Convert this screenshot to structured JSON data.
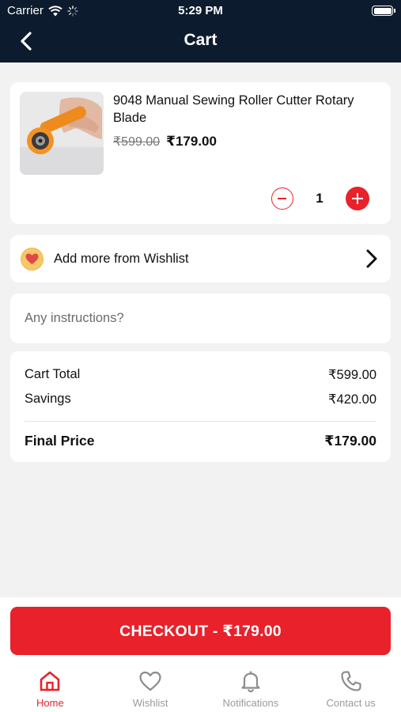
{
  "status": {
    "carrier": "Carrier",
    "time": "5:29 PM"
  },
  "header": {
    "title": "Cart"
  },
  "cart_item": {
    "name": "9048 Manual Sewing Roller Cutter Rotary Blade",
    "original_price": "₹599.00",
    "price": "₹179.00",
    "quantity": "1"
  },
  "wishlist_link": {
    "label": "Add more from Wishlist"
  },
  "instructions": {
    "placeholder": "Any instructions?"
  },
  "summary": {
    "cart_total_label": "Cart Total",
    "cart_total_value": "₹599.00",
    "savings_label": "Savings",
    "savings_value": "₹420.00",
    "final_label": "Final Price",
    "final_value": "₹179.00"
  },
  "checkout": {
    "label": "CHECKOUT - ₹179.00"
  },
  "tabs": [
    {
      "label": "Home",
      "icon": "home-icon",
      "active": true
    },
    {
      "label": "Wishlist",
      "icon": "heart-icon",
      "active": false
    },
    {
      "label": "Notifications",
      "icon": "bell-icon",
      "active": false
    },
    {
      "label": "Contact us",
      "icon": "phone-icon",
      "active": false
    }
  ],
  "colors": {
    "accent": "#e8212b",
    "header_bg": "#0d1b2e",
    "background": "#f2f2f2"
  }
}
